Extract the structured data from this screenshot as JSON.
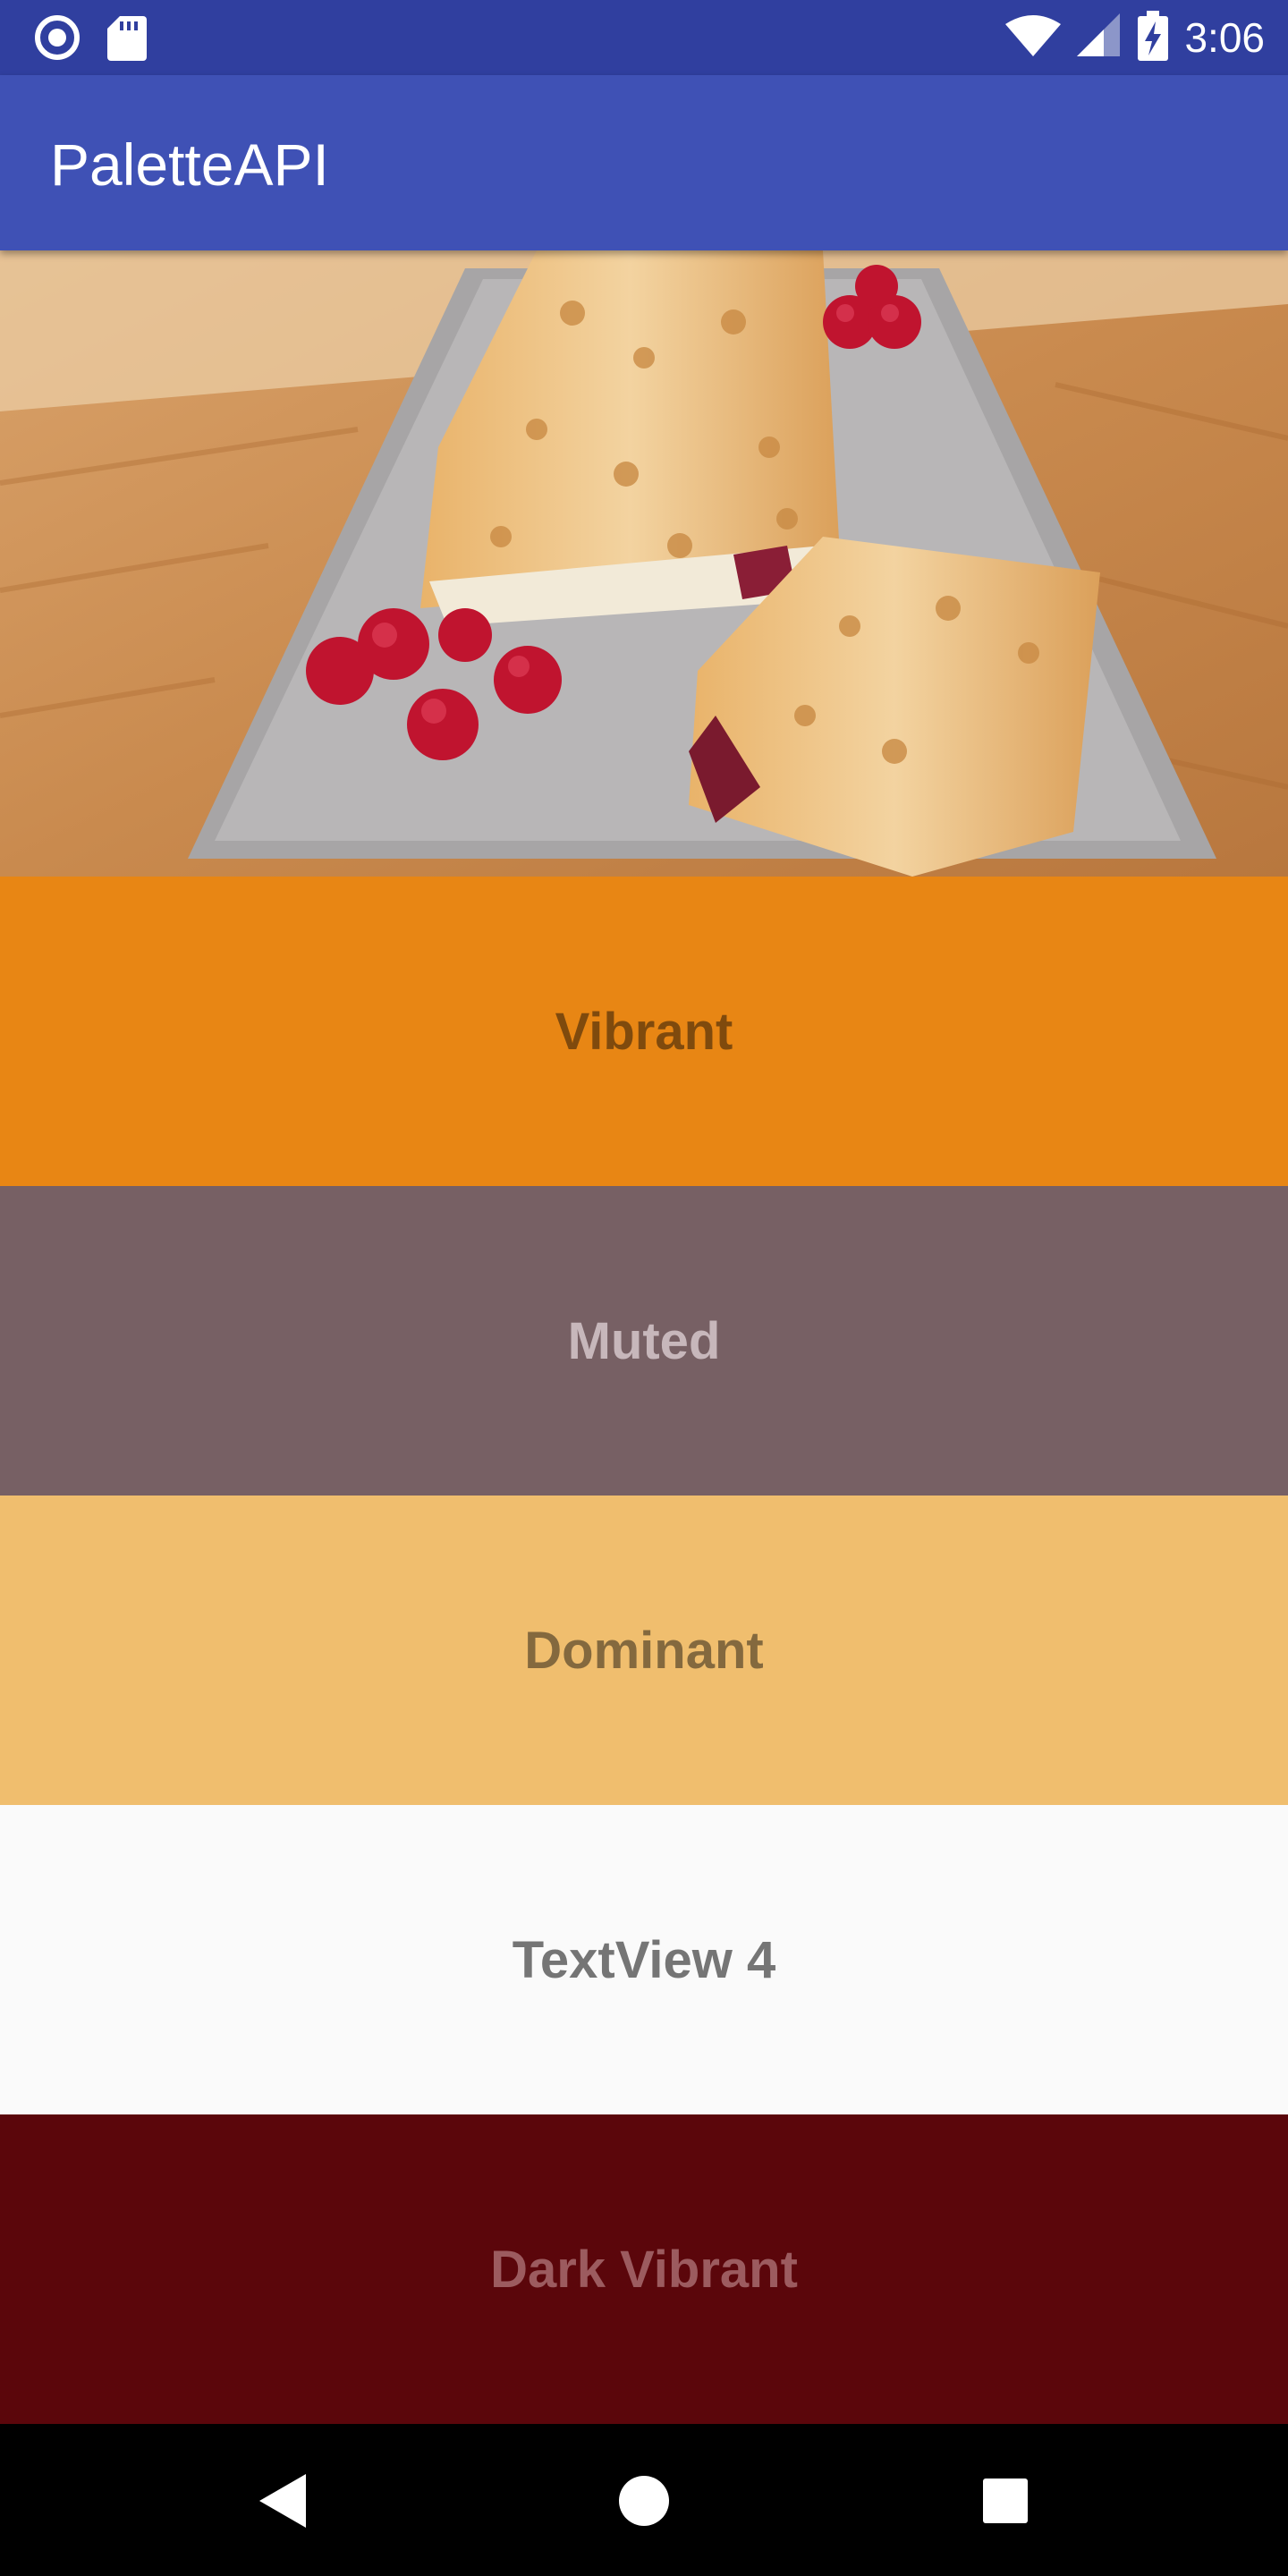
{
  "status_bar": {
    "time": "3:06",
    "icons_left": [
      "record-icon",
      "sd-card-icon"
    ],
    "icons_right": [
      "wifi-icon",
      "signal-icon",
      "battery-charging-icon"
    ]
  },
  "app_bar": {
    "title": "PaletteAPI"
  },
  "hero_image": {
    "subject": "pastry-on-plate-image"
  },
  "swatches": [
    {
      "label": "Vibrant",
      "background": "#e88614",
      "text_color": "#7f4a0d"
    },
    {
      "label": "Muted",
      "background": "#776064",
      "text_color": "#c7b7bb"
    },
    {
      "label": "Dominant",
      "background": "#f0be6e",
      "text_color": "#84693e"
    },
    {
      "label": "TextView 4",
      "background": "#fafafa",
      "text_color": "#757575"
    },
    {
      "label": "Dark Vibrant",
      "background": "#5b060b",
      "text_color": "#9c5b5f"
    }
  ],
  "nav_bar": {
    "buttons": [
      "back-icon",
      "home-icon",
      "recents-icon"
    ]
  }
}
